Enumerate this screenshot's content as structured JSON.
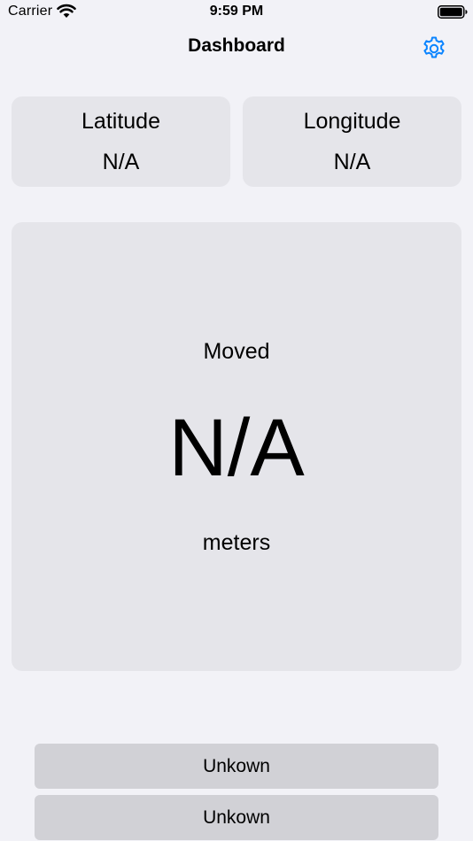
{
  "status_bar": {
    "carrier": "Carrier",
    "time": "9:59 PM",
    "wifi_icon": "wifi-icon",
    "battery_icon": "battery-icon"
  },
  "nav": {
    "title": "Dashboard",
    "settings_icon": "gear-icon",
    "accent_color": "#0a84ff"
  },
  "coordinates": {
    "latitude": {
      "label": "Latitude",
      "value": "N/A"
    },
    "longitude": {
      "label": "Longitude",
      "value": "N/A"
    }
  },
  "movement": {
    "label": "Moved",
    "value": "N/A",
    "unit": "meters"
  },
  "buttons": [
    {
      "label": "Unkown"
    },
    {
      "label": "Unkown"
    }
  ],
  "colors": {
    "background": "#f2f2f7",
    "card": "#e5e5ea",
    "button": "#d1d1d6"
  }
}
